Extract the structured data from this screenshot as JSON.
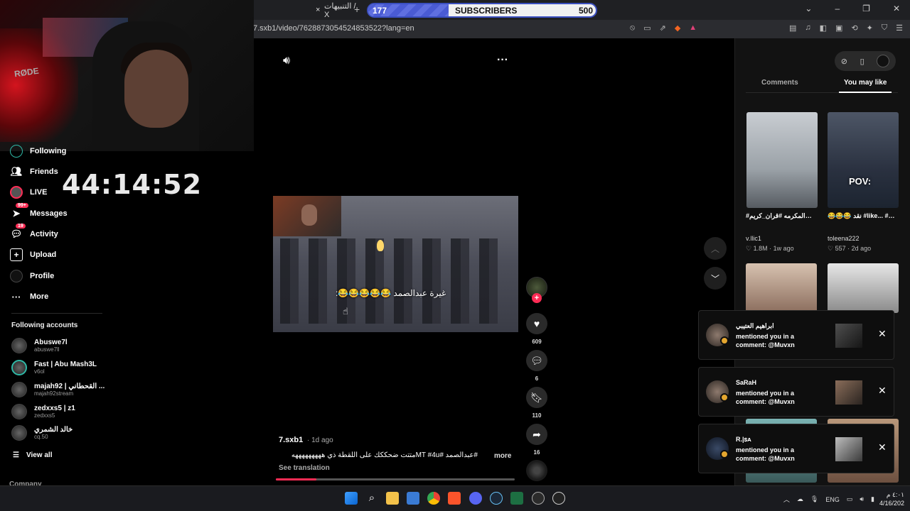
{
  "browser": {
    "tab_title": "التنبيهات / X",
    "tab_close": "×",
    "new_tab": "+",
    "url": "7.sxb1/video/7628873054524853522?lang=en",
    "window_controls": [
      "⌄",
      "–",
      "❐",
      "✕"
    ]
  },
  "subscribers": {
    "count": "177",
    "label": "SUBSCRIBERS",
    "goal": "500",
    "progress": 0.354
  },
  "webcam": {
    "mic_brand": "RØDE"
  },
  "timer": "44:14:52",
  "sidebar": {
    "nav": [
      {
        "label": "Following",
        "icon": "following-icon"
      },
      {
        "label": "Friends",
        "icon": "friends-icon"
      },
      {
        "label": "LIVE",
        "icon": "live-icon"
      },
      {
        "label": "Messages",
        "icon": "messages-icon",
        "badge": "99+"
      },
      {
        "label": "Activity",
        "icon": "activity-icon",
        "badge": "19"
      },
      {
        "label": "Upload",
        "icon": "upload-icon"
      },
      {
        "label": "Profile",
        "icon": "profile-icon"
      },
      {
        "label": "More",
        "icon": "more-icon"
      }
    ],
    "following_title": "Following accounts",
    "accounts": [
      {
        "name": "Abuswe7l",
        "handle": "abuswe7ll"
      },
      {
        "name": "Fast | Abu Mash3L",
        "handle": "v6ol"
      },
      {
        "name": "majah92 | القحطاني ...",
        "handle": "majah92stream"
      },
      {
        "name": "zedxxs5 | z1",
        "handle": "zedxxs5"
      },
      {
        "name": "خالد الشمري",
        "handle": "cq.50"
      }
    ],
    "view_all": "View all",
    "company": "Company"
  },
  "video": {
    "caption": "غيرة عبدالصمد 😂😂😂😂😂:",
    "author": "7.sxb1",
    "time": " · 1d ago",
    "description": "#عبدالصمد #MT #4uمتتت ضحككك على اللقطة ذي هههههههههه",
    "more": "more",
    "see_translation": "See translation",
    "progress": 0.17
  },
  "actions": {
    "likes": "609",
    "comments": "6",
    "saves": "110",
    "shares": "16"
  },
  "right_panel": {
    "tab_comments": "Comments",
    "tab_you_may_like": "You may like",
    "videos": [
      {
        "title": "#مكه_المكرمه #قران_كريم ...",
        "author": "v.llic1",
        "meta": "♡ 1.8M · 1w ago"
      },
      {
        "title": "😂😂😂 نقد #like... #فورسيجل",
        "author": "toleena222",
        "meta": "♡ 557 · 2d ago",
        "overlay": "POV:"
      }
    ]
  },
  "notifications": [
    {
      "name": "ابراهيم العتيبي",
      "text": "mentioned you in a comment: @Muvxn"
    },
    {
      "name": "SaRaH",
      "text": "mentioned you in a comment: @Muvxn"
    },
    {
      "name": "R.|ꜱᴀ",
      "text": "mentioned you in a comment: @Muvxn"
    }
  ],
  "taskbar": {
    "tray_lang": "ENG",
    "time": "٤:٠١ م",
    "date": "4/16/202"
  }
}
